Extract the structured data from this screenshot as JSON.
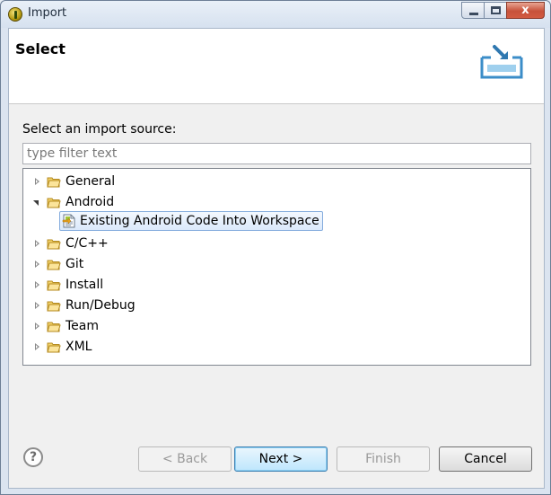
{
  "window": {
    "title": "Import"
  },
  "banner": {
    "title": "Select"
  },
  "prompt": "Select an import source:",
  "filter": {
    "placeholder": "type filter text",
    "value": ""
  },
  "tree": {
    "items": [
      {
        "label": "General",
        "expanded": false,
        "icon": "folder-icon"
      },
      {
        "label": "Android",
        "expanded": true,
        "icon": "folder-icon",
        "children": [
          {
            "label": "Existing Android Code Into Workspace",
            "icon": "android-import-icon",
            "selected": true
          }
        ]
      },
      {
        "label": "C/C++",
        "expanded": false,
        "icon": "folder-icon"
      },
      {
        "label": "Git",
        "expanded": false,
        "icon": "folder-icon"
      },
      {
        "label": "Install",
        "expanded": false,
        "icon": "folder-icon"
      },
      {
        "label": "Run/Debug",
        "expanded": false,
        "icon": "folder-icon"
      },
      {
        "label": "Team",
        "expanded": false,
        "icon": "folder-icon"
      },
      {
        "label": "XML",
        "expanded": false,
        "icon": "folder-icon"
      }
    ]
  },
  "buttons": {
    "help": "?",
    "back": "< Back",
    "next": "Next >",
    "finish": "Finish",
    "cancel": "Cancel"
  },
  "window_controls": {
    "close": "x"
  },
  "colors": {
    "selection": "#dbe9fb",
    "folder": "#f5c542",
    "banner": "#ffffff"
  }
}
